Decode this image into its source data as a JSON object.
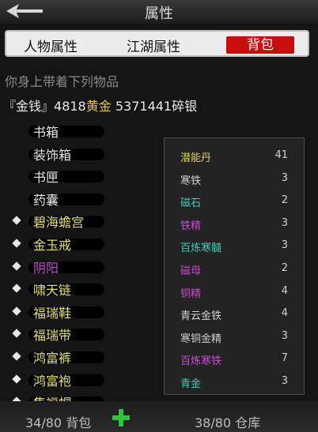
{
  "header": {
    "title": "属性",
    "back_icon": "back-arrow-icon"
  },
  "tabs": [
    {
      "label": "人物属性",
      "active": false
    },
    {
      "label": "江湖属性",
      "active": false
    },
    {
      "label": "背包",
      "active": true
    }
  ],
  "carry_label": "你身上带着下列物品",
  "money": {
    "prefix": "『金钱』",
    "gold_value": "4818",
    "gold_label": "黄金",
    "silver_value": "5371441",
    "silver_label": "碎银"
  },
  "categories": [
    {
      "label": "书箱",
      "bullet": false,
      "color": "#e8e8e8"
    },
    {
      "label": "装饰箱",
      "bullet": false,
      "color": "#e8e8e8"
    },
    {
      "label": "书匣",
      "bullet": false,
      "color": "#e8e8e8"
    },
    {
      "label": "药囊",
      "bullet": false,
      "color": "#e8e8e8"
    },
    {
      "label": "碧海蟾宫",
      "bullet": true,
      "color": "#e8e070"
    },
    {
      "label": "金玉戒",
      "bullet": true,
      "color": "#e8e070"
    },
    {
      "label": "阴阳",
      "bullet": true,
      "color": "#c94ad6"
    },
    {
      "label": "啸天链",
      "bullet": true,
      "color": "#e8e070"
    },
    {
      "label": "福瑞鞋",
      "bullet": true,
      "color": "#e8e070"
    },
    {
      "label": "福瑞带",
      "bullet": true,
      "color": "#e8e070"
    },
    {
      "label": "鸿富裤",
      "bullet": true,
      "color": "#e8e070"
    },
    {
      "label": "鸿富袍",
      "bullet": true,
      "color": "#e8e070"
    }
  ],
  "partial_category": {
    "label": "集福帽",
    "color": "#e8e070"
  },
  "items": [
    {
      "name": "潜能丹",
      "count": "41",
      "color": "#e0d060"
    },
    {
      "name": "寒铁",
      "count": "3",
      "color": "#d0d0d0"
    },
    {
      "name": "磁石",
      "count": "2",
      "color": "#41c8c0"
    },
    {
      "name": "铁精",
      "count": "3",
      "color": "#c84ad0"
    },
    {
      "name": "百炼寒髓",
      "count": "3",
      "color": "#41c8c0"
    },
    {
      "name": "磁母",
      "count": "2",
      "color": "#c84ad0"
    },
    {
      "name": "铜精",
      "count": "4",
      "color": "#c84ad0"
    },
    {
      "name": "青云金铁",
      "count": "4",
      "color": "#d0d0d0"
    },
    {
      "name": "寒铜金精",
      "count": "3",
      "color": "#d0d0d0"
    },
    {
      "name": "百炼寒铁",
      "count": "7",
      "color": "#c84ad0"
    },
    {
      "name": "青金",
      "count": "3",
      "color": "#41c8c0"
    }
  ],
  "footer": {
    "bag_text": "34/80 背包",
    "storage_text": "38/80 仓库",
    "add_icon": "plus-icon",
    "accent": "#2fc43a"
  }
}
